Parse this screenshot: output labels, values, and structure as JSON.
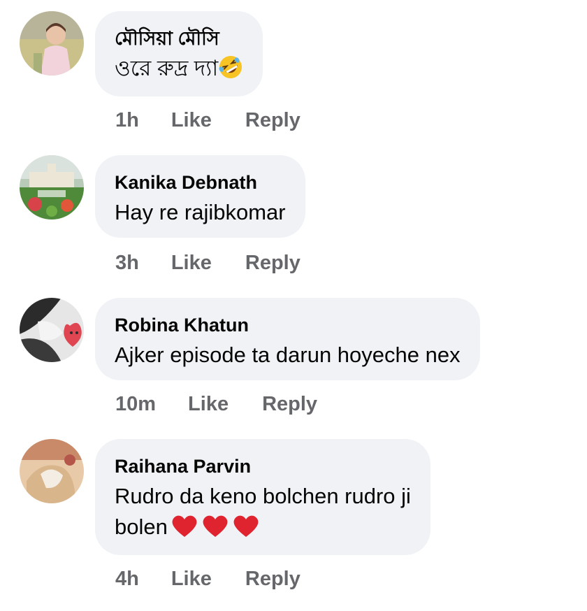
{
  "comments": [
    {
      "author": "মৌসিয়া মৌসি",
      "text": "ওরে রুদ্র দ্যা",
      "emoji": "rolling-on-floor-laughing-emoji",
      "time": "1h",
      "like": "Like",
      "reply": "Reply"
    },
    {
      "author": "Kanika Debnath",
      "text": "Hay re rajibkomar",
      "time": "3h",
      "like": "Like",
      "reply": "Reply"
    },
    {
      "author": "Robina Khatun",
      "text": "Ajker episode ta darun hoyeche nex",
      "time": "10m",
      "like": "Like",
      "reply": "Reply"
    },
    {
      "author": "Raihana Parvin",
      "text_line1": "Rudro da keno bolchen rudro ji",
      "text_line2": "bolen",
      "emoji": "red-heart-emoji",
      "time": "4h",
      "like": "Like",
      "reply": "Reply"
    }
  ],
  "colors": {
    "bubble": "#f0f2f5",
    "meta": "#65676b",
    "text": "#050505",
    "heart": "#e0242f"
  }
}
